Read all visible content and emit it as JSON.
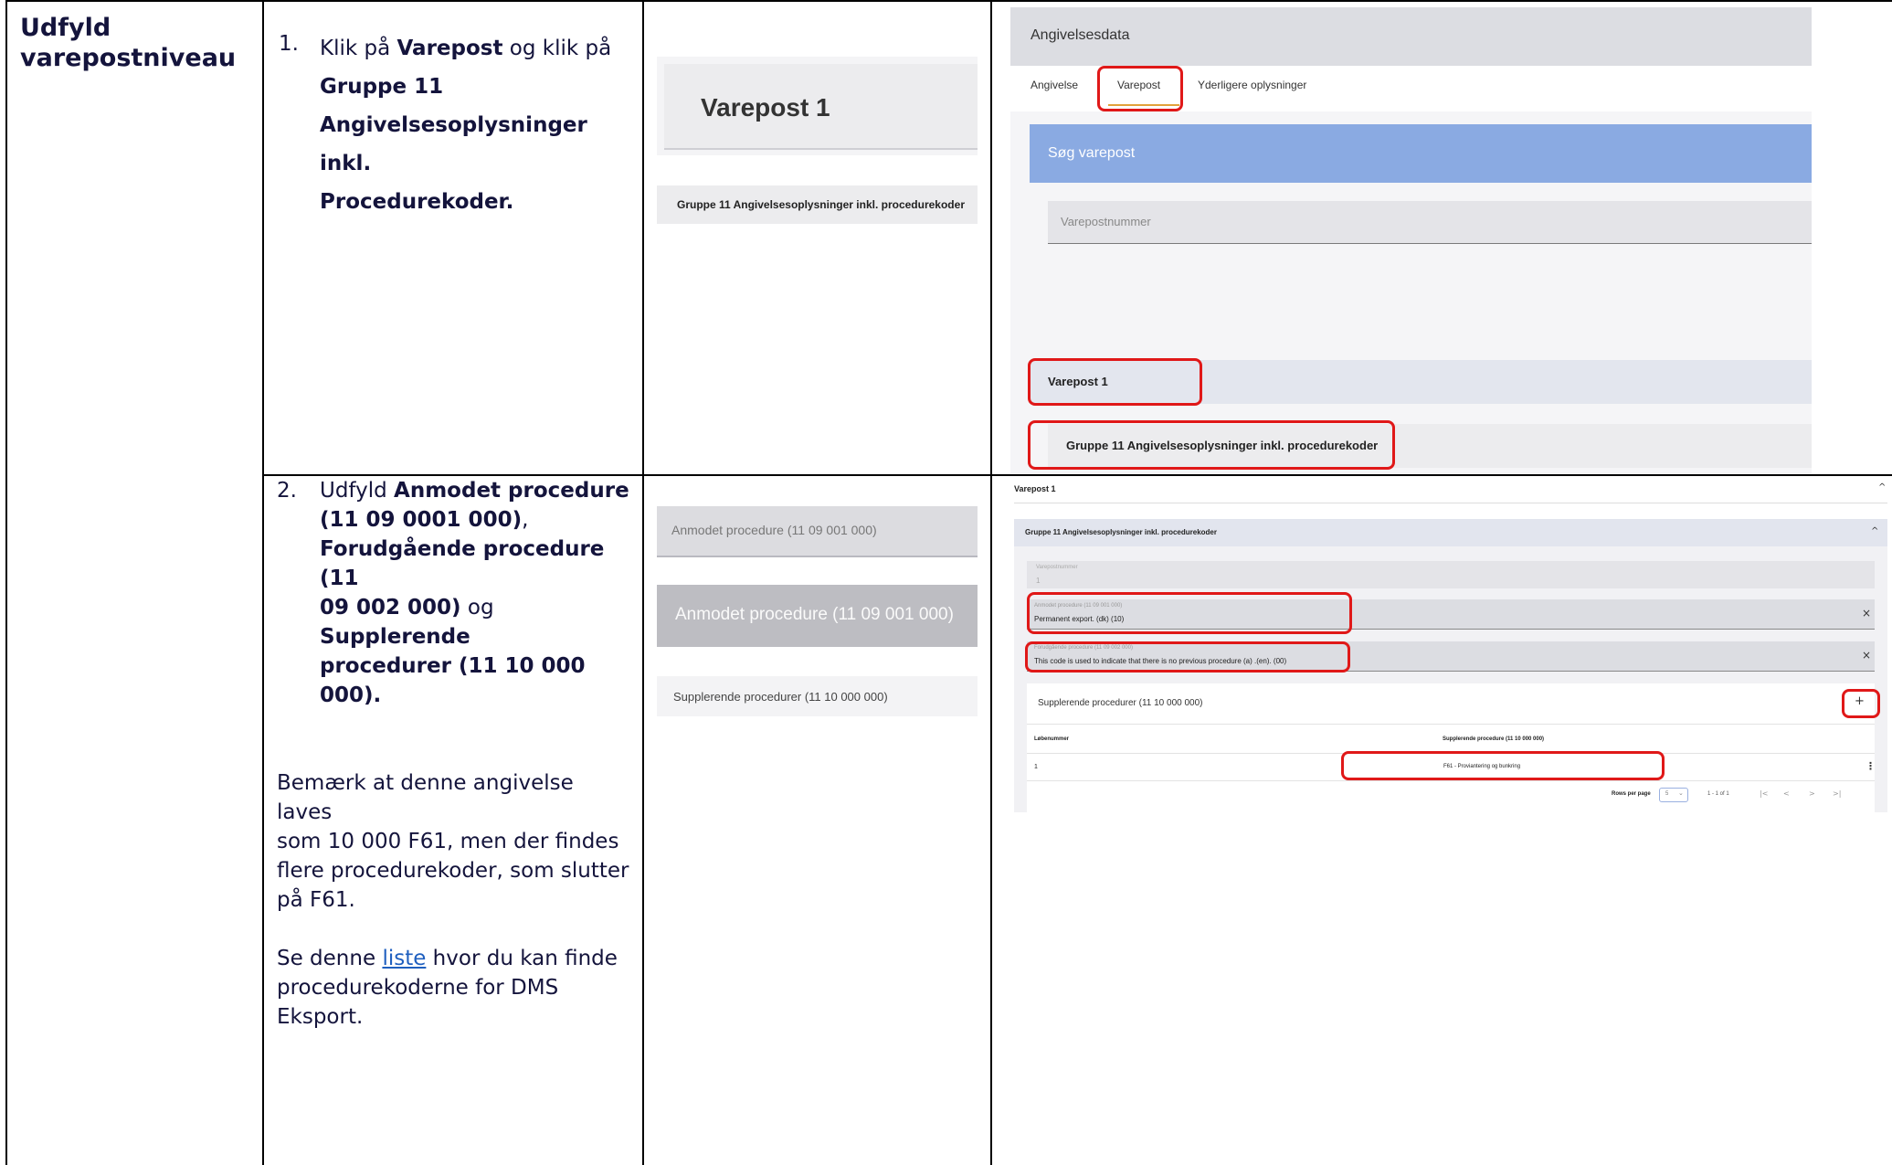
{
  "heading": "Udfyld varepostniveau",
  "step1": {
    "number": "1.",
    "pre": "Klik på ",
    "bold1": "Varepost",
    "mid": " og klik på",
    "bold2_line1": "Gruppe 11",
    "bold2_line2": "Angivelsesoplysninger inkl.",
    "bold2_line3": "Procedurekoder."
  },
  "step2": {
    "number": "2.",
    "l1_pre": "Udfyld ",
    "l1_bold": "Anmodet procedure",
    "l2_bold": "(11 09 0001 000)",
    "l2_post": ",",
    "l3_bold": "Forudgående procedure (11",
    "l4_bold": "09 002 000)",
    "l4_mid": " og ",
    "l4_bold2": "Supplerende",
    "l5_bold": "procedurer (11 10 000 000).",
    "note1_l1": "Bemærk at denne angivelse laves",
    "note1_l2": "som 10 000 F61, men der findes",
    "note1_l3": "flere procedurekoder, som slutter",
    "note1_l4": "på F61.",
    "note2_pre": "Se denne ",
    "note2_link": "liste",
    "note2_post": " hvor du kan finde",
    "note2_l2": "procedurekoderne for DMS",
    "note2_l3": "Eksport."
  },
  "mid1": {
    "varepost_title": "Varepost 1",
    "gruppe_label": "Gruppe 11 Angivelsesoplysninger inkl. procedurekoder"
  },
  "mid2": {
    "field1": "Anmodet procedure (11 09 001 000)",
    "field2": "Anmodet procedure (11 09 001 000)",
    "field3": "Supplerende procedurer (11 10 000 000)"
  },
  "shot1": {
    "header": "Angivelsesdata",
    "tabs": [
      "Angivelse",
      "Varepost",
      "Yderligere oplysninger"
    ],
    "search_title": "Søg varepost",
    "search_placeholder": "Varepostnummer",
    "varepost": "Varepost 1",
    "gruppe": "Gruppe 11 Angivelsesoplysninger inkl. procedurekoder"
  },
  "shot2": {
    "varepost": "Varepost 1",
    "gruppe": "Gruppe 11 Angivelsesoplysninger inkl. procedurekoder",
    "varepostnummer_label": "Varepostnummer",
    "varepostnummer_value": "1",
    "anmodet_label": "Anmodet procedure (11 09 001 000)",
    "anmodet_value": "Permanent export. (dk) (10)",
    "forud_label": "Forudgående procedure (11 09 002 000)",
    "forud_value": "This code is used to indicate that there is no previous procedure (a) .(en). (00)",
    "suppl_title": "Supplerende procedurer (11 10 000 000)",
    "col_lobenummer": "Løbenummer",
    "col_suppl": "Supplerende procedure (11 10 000 000)",
    "row_num": "1",
    "row_value": "F61 - Proviantering og bunkring",
    "rows_per_page": "Rows per page",
    "rows_value": "5",
    "range": "1 - 1 of 1"
  }
}
